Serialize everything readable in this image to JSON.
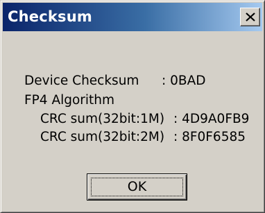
{
  "window": {
    "title": "Checksum"
  },
  "content": {
    "device_checksum_label": "Device Checksum",
    "device_checksum_value": ": 0BAD",
    "algorithm_label": "FP4 Algorithm",
    "crc_1m_label": "CRC sum(32bit:1M)",
    "crc_1m_value": ": 4D9A0FB9",
    "crc_2m_label": "CRC sum(32bit:2M)",
    "crc_2m_value": ": 8F0F6585"
  },
  "buttons": {
    "ok_label": "OK",
    "close_icon": "close-x-icon"
  },
  "colors": {
    "titlebar_start": "#0a246a",
    "titlebar_end": "#a6caf0",
    "dialog_face": "#d4d0c8"
  }
}
